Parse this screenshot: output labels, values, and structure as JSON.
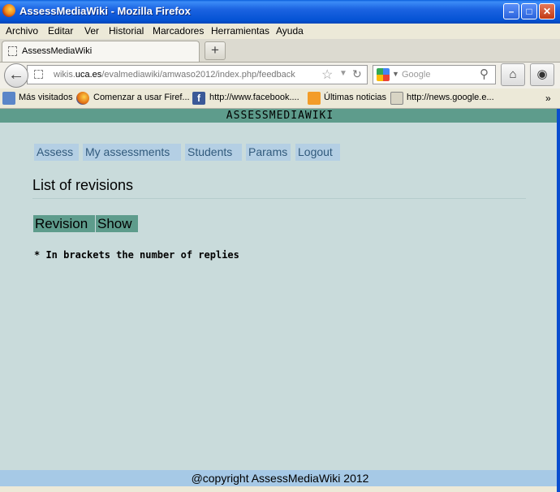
{
  "window": {
    "title": "AssessMediaWiki - Mozilla Firefox"
  },
  "menu": [
    "Archivo",
    "Editar",
    "Ver",
    "Historial",
    "Marcadores",
    "Herramientas",
    "Ayuda"
  ],
  "tab": {
    "title": "AssessMediaWiki",
    "new_tab_symbol": "+"
  },
  "address": {
    "url_prefix": "wikis.",
    "url_domain": "uca.es",
    "url_rest": "/evalmediawiki/amwaso2012/index.php/feedback",
    "search_placeholder": "Google"
  },
  "bookmarks": [
    {
      "label": "Más visitados",
      "icon": "most-visited-icon"
    },
    {
      "label": "Comenzar a usar Firef...",
      "icon": "firefox-icon"
    },
    {
      "label": "http://www.facebook....",
      "icon": "facebook-icon"
    },
    {
      "label": "Últimas noticias",
      "icon": "rss-icon"
    },
    {
      "label": "http://news.google.e...",
      "icon": "news-icon"
    }
  ],
  "site": {
    "header": "ASSESSMEDIAWIKI",
    "nav": [
      "Assess",
      "My assessments",
      "Students",
      "Params",
      "Logout"
    ],
    "heading": "List of revisions",
    "table_headers": [
      "Revision",
      "Show"
    ],
    "note": "* In brackets the number of replies",
    "footer": "@copyright AssessMediaWiki 2012"
  },
  "colors": {
    "page_bg": "#c9dbdb",
    "header_bg": "#5e9c8c",
    "nav_bg": "#b4cfe4",
    "footer_bg": "#a6c9e6"
  }
}
